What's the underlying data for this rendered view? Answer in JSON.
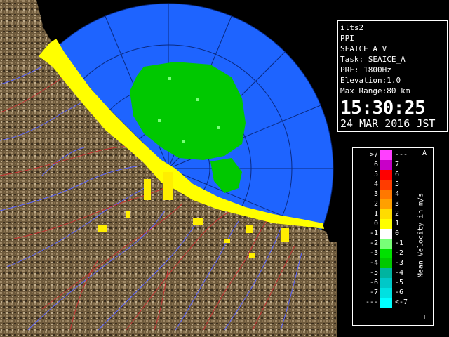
{
  "info": {
    "lines": [
      "ilts2",
      "PPI",
      "SEAICE_A_V",
      "Task: SEAICE_A",
      "PRF: 1800Hz",
      "Elevation:1.0",
      "Max Range:80 km"
    ],
    "time": "15:30:25",
    "date": "24 MAR 2016 JST"
  },
  "legend": {
    "title": "Mean Velocity in m/s",
    "top_marker": "A",
    "bottom_marker": "T",
    "rows": [
      {
        "left": ">7",
        "right": "---",
        "color": "#ff40ff"
      },
      {
        "left": "6",
        "right": "7",
        "color": "#c800c8"
      },
      {
        "left": "5",
        "right": "6",
        "color": "#ff0000"
      },
      {
        "left": "4",
        "right": "5",
        "color": "#ff3c00"
      },
      {
        "left": "3",
        "right": "4",
        "color": "#ff7800"
      },
      {
        "left": "2",
        "right": "3",
        "color": "#ffa000"
      },
      {
        "left": "1",
        "right": "2",
        "color": "#ffdc00"
      },
      {
        "left": "0",
        "right": "1",
        "color": "#ffff00"
      },
      {
        "left": "-1",
        "right": "0",
        "color": "#ffffff"
      },
      {
        "left": "-2",
        "right": "-1",
        "color": "#78ff78"
      },
      {
        "left": "-3",
        "right": "-2",
        "color": "#00e100"
      },
      {
        "left": "-4",
        "right": "-3",
        "color": "#00c800"
      },
      {
        "left": "-5",
        "right": "-4",
        "color": "#00b4a0"
      },
      {
        "left": "-6",
        "right": "-5",
        "color": "#00c8c8"
      },
      {
        "left": "-7",
        "right": "-6",
        "color": "#00e1e1"
      },
      {
        "left": "---",
        "right": "<-7",
        "color": "#00ffff"
      }
    ]
  },
  "map": {
    "background_color": "#000000",
    "ocean_color": "#1e64ff",
    "terrain_color": "#6e5a3c",
    "range_ring_color": "#0a2a80",
    "coast_color": "#ffff00",
    "echo_color": "#00c800"
  }
}
